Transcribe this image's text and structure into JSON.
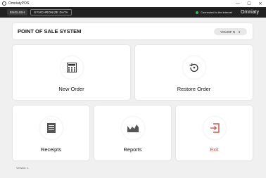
{
  "window": {
    "title": "OmniatyPOS",
    "minimize": "—",
    "maximize": "☐",
    "close": "✕"
  },
  "appbar": {
    "language_button": "ENGLISH",
    "sync_button": "SYNCHRONIZE DATA",
    "connection_status": "Connected to the internet",
    "connection_color": "#22c55e",
    "brand": "Omniaty"
  },
  "header": {
    "title": "POINT OF SALE SYSTEM",
    "user_dropdown": "YOUSIF N",
    "user_caret": "▼"
  },
  "tiles": {
    "new_order": {
      "label": "New Order",
      "icon": "calculator-icon"
    },
    "restore_order": {
      "label": "Restore Order",
      "icon": "restore-icon"
    },
    "receipts": {
      "label": "Receipts",
      "icon": "receipt-icon"
    },
    "reports": {
      "label": "Reports",
      "icon": "area-chart-icon"
    },
    "exit": {
      "label": "Exit",
      "icon": "exit-icon",
      "color": "#d9534f"
    }
  },
  "footer": {
    "version": "Version: 1"
  }
}
